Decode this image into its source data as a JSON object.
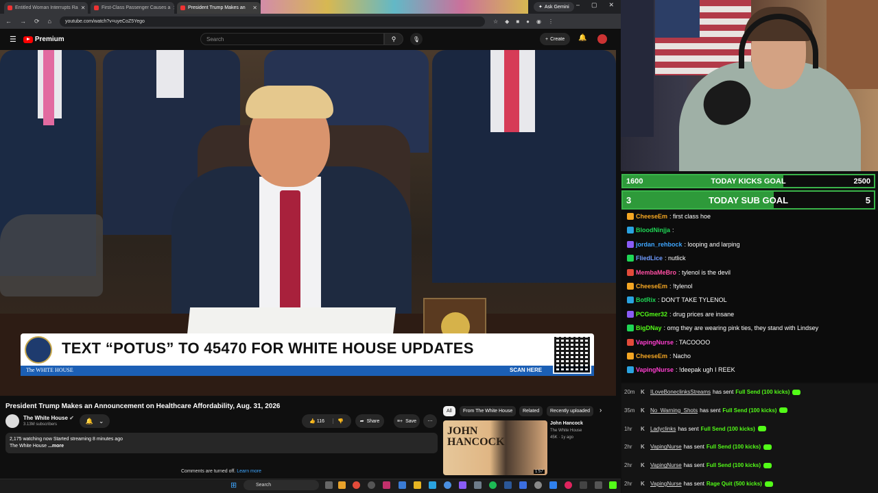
{
  "browser": {
    "tabs": [
      {
        "title": "Entitled Woman Interrupts Ra",
        "active": false
      },
      {
        "title": "First-Class Passenger Causes a",
        "active": false
      },
      {
        "title": "President Trump Makes an",
        "active": true
      }
    ],
    "ask_gemini": "Ask Gemini",
    "url": "youtube.com/watch?v=uyeCoZ5Yego"
  },
  "youtube": {
    "brand": "Premium",
    "search_placeholder": "Search",
    "create_label": "Create",
    "video": {
      "banner_text": "TEXT “POTUS” TO 45470 FOR WHITE HOUSE UPDATES",
      "banner_source": "The WHITE HOUSE",
      "banner_cta": "SCAN HERE"
    },
    "title": "President Trump Makes an Announcement on Healthcare Affordability, Aug. 31, 2026",
    "channel": {
      "name": "The White House",
      "subscribers": "3.13M subscribers"
    },
    "likes": "116",
    "share_label": "Share",
    "save_label": "Save",
    "description": {
      "line1": "2,175 watching now  Started streaming 8 minutes ago",
      "line2": "The White House ",
      "more": "...more"
    },
    "comments_off": "Comments are turned off.",
    "learn_more": "Learn more",
    "chips": [
      "All",
      "From The White House",
      "Related",
      "Recently uploaded"
    ],
    "related": {
      "thumb_title": "JOHN HANCOCK",
      "title": "John Hancock",
      "channel": "The White House",
      "stats": "45K · 1y ago",
      "duration": "1:57"
    }
  },
  "taskbar": {
    "search": "Search"
  },
  "stream": {
    "goals": [
      {
        "label": "TODAY KICKS GOAL",
        "current": "1600",
        "target": "2500",
        "progress": 0.64
      },
      {
        "label": "TODAY SUB GOAL",
        "current": "3",
        "target": "5",
        "progress": 0.6
      }
    ],
    "colors": {
      "accent": "#53fc18",
      "goal_fill": "#2e9a3a"
    },
    "chat": [
      {
        "user": "CheeseEm",
        "text": "first class hoe",
        "color": "#f5a623"
      },
      {
        "user": "BloodNinjja",
        "text": "",
        "color": "#1fd655"
      },
      {
        "user": "jordan_rehbock",
        "text": "looping and larping",
        "color": "#3ea6ff"
      },
      {
        "user": "FliedLice",
        "text": "nutlick",
        "color": "#6f9bff"
      },
      {
        "user": "MembaMeBro",
        "text": "tylenol is the devil",
        "color": "#ff4fa3"
      },
      {
        "user": "CheeseEm",
        "text": "!tylenol",
        "color": "#f5a623"
      },
      {
        "user": "BotRix",
        "text": "DON'T TAKE TYLENOL",
        "color": "#1fd655"
      },
      {
        "user": "PCGmer32",
        "text": "drug prices are insane",
        "color": "#53fc18"
      },
      {
        "user": "BigDNay",
        "text": "omg they are wearing pink ties, they stand with Lindsey",
        "color": "#53fc18"
      },
      {
        "user": "VapingNurse",
        "text": "TACOOOO",
        "color": "#ff3fd0"
      },
      {
        "user": "CheeseEm",
        "text": "Nacho",
        "color": "#f5a623"
      },
      {
        "user": "VapingNurse",
        "text": "!deepak ugh I REEK",
        "color": "#ff3fd0"
      }
    ],
    "feed": [
      {
        "time": "20m",
        "user": "ILoveBoneclinksStreams",
        "action": "has sent",
        "gift": "Full Send (100 kicks)"
      },
      {
        "time": "35m",
        "user": "No_Warning_Shots",
        "action": "has sent",
        "gift": "Full Send (100 kicks)"
      },
      {
        "time": "1hr",
        "user": "Ladyclinks",
        "action": "has sent",
        "gift": "Full Send (100 kicks)"
      },
      {
        "time": "2hr",
        "user": "VapingNurse",
        "action": "has sent",
        "gift": "Full Send (100 kicks)"
      },
      {
        "time": "2hr",
        "user": "VapingNurse",
        "action": "has sent",
        "gift": "Full Send (100 kicks)"
      },
      {
        "time": "2hr",
        "user": "VapingNurse",
        "action": "has sent",
        "gift": "Rage Quit (500 kicks)"
      }
    ]
  }
}
